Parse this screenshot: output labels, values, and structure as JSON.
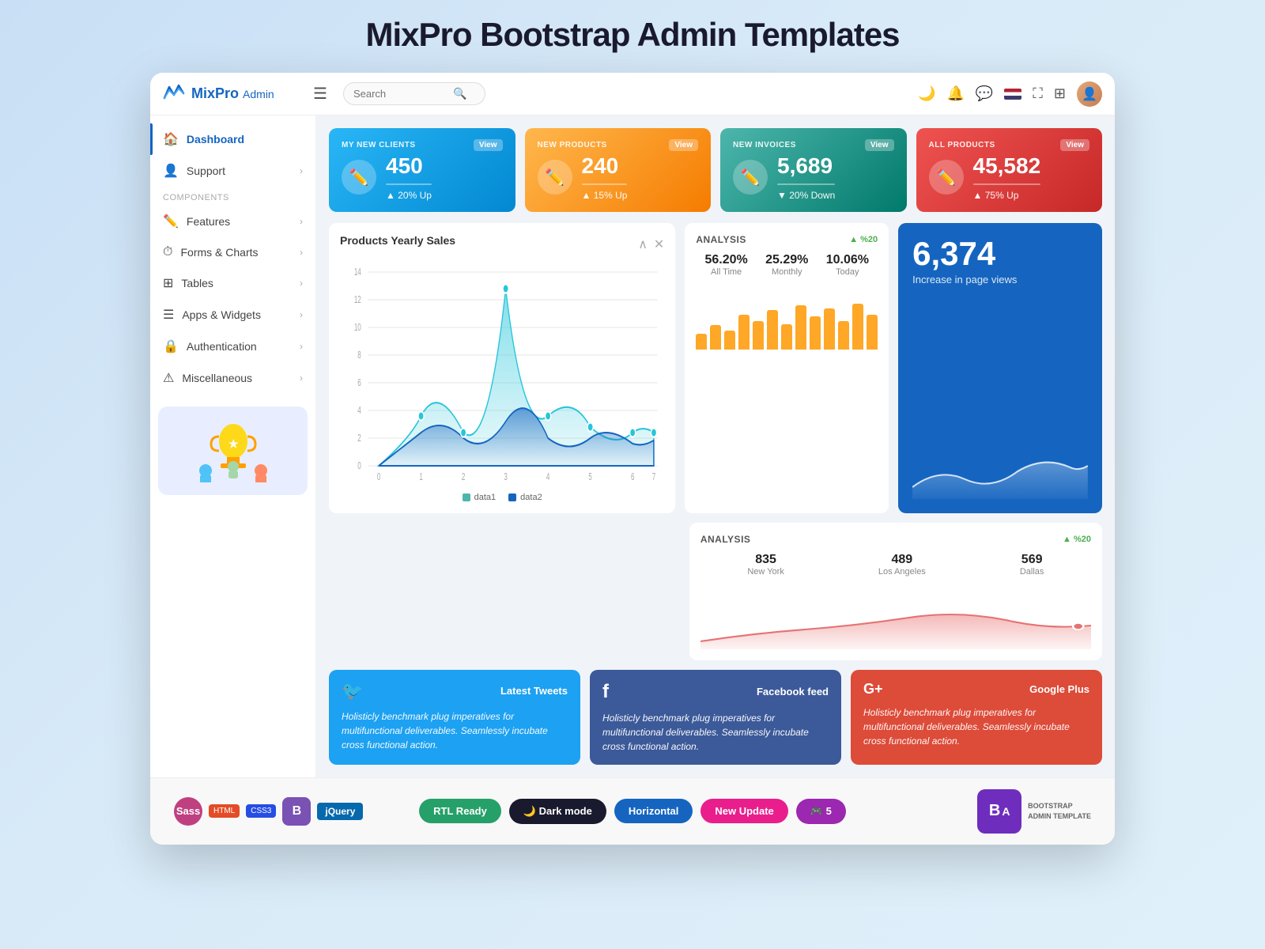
{
  "page": {
    "title": "MixPro Bootstrap Admin Templates"
  },
  "topbar": {
    "logo_brand": "MixPro",
    "logo_sub": "Admin",
    "search_placeholder": "Search",
    "hamburger_label": "☰"
  },
  "sidebar": {
    "items": [
      {
        "label": "Dashboard",
        "icon": "🏠",
        "active": true
      },
      {
        "label": "Support",
        "icon": "👤",
        "has_arrow": true
      },
      {
        "label": "Features",
        "icon": "✏️",
        "has_arrow": true
      },
      {
        "label": "Forms & Charts",
        "icon": "⏱",
        "has_arrow": true
      },
      {
        "label": "Tables",
        "icon": "⊞",
        "has_arrow": true
      },
      {
        "label": "Apps & Widgets",
        "icon": "☰",
        "has_arrow": true
      },
      {
        "label": "Authentication",
        "icon": "🔒",
        "has_arrow": true
      },
      {
        "label": "Miscellaneous",
        "icon": "⚠",
        "has_arrow": true
      }
    ],
    "section_label": "Components"
  },
  "stat_cards": [
    {
      "label": "MY NEW CLIENTS",
      "value": "450",
      "change": "20% Up",
      "change_dir": "up",
      "view_label": "View",
      "color": "blue"
    },
    {
      "label": "NEW PRODUCTS",
      "value": "240",
      "change": "15% Up",
      "change_dir": "up",
      "view_label": "View",
      "color": "orange"
    },
    {
      "label": "NEW INVOICES",
      "value": "5,689",
      "change": "20% Down",
      "change_dir": "down",
      "view_label": "View",
      "color": "teal"
    },
    {
      "label": "ALL PRODUCTS",
      "value": "45,582",
      "change": "75% Up",
      "change_dir": "up",
      "view_label": "View",
      "color": "red"
    }
  ],
  "yearly_chart": {
    "title": "Products Yearly Sales",
    "data1_label": "data1",
    "data2_label": "data2"
  },
  "analysis1": {
    "label": "ANALYSIS",
    "badge": "▲ %20",
    "stats": [
      {
        "value": "56.20%",
        "label": "All Time"
      },
      {
        "value": "25.29%",
        "label": "Monthly"
      },
      {
        "value": "10.06%",
        "label": "Today"
      }
    ],
    "bars": [
      3,
      5,
      4,
      7,
      6,
      8,
      5,
      9,
      7,
      8,
      6,
      9,
      7
    ]
  },
  "big_card": {
    "number": "6,374",
    "label": "Increase in page views"
  },
  "analysis2": {
    "label": "ANALYSIS",
    "badge": "▲ %20",
    "stats": [
      {
        "value": "835",
        "label": "New York"
      },
      {
        "value": "489",
        "label": "Los Angeles"
      },
      {
        "value": "569",
        "label": "Dallas"
      }
    ]
  },
  "social_cards": [
    {
      "platform": "twitter",
      "icon": "𝕏",
      "title": "Latest Tweets",
      "text": "Holisticly benchmark plug imperatives for multifunctional deliverables. Seamlessly incubate cross functional action."
    },
    {
      "platform": "facebook",
      "icon": "f",
      "title": "Facebook feed",
      "text": "Holisticly benchmark plug imperatives for multifunctional deliverables. Seamlessly incubate cross functional action."
    },
    {
      "platform": "gplus",
      "icon": "G+",
      "title": "Google Plus",
      "text": "Holisticly benchmark plug imperatives for multifunctional deliverables. Seamlessly incubate cross functional action."
    }
  ],
  "bottom_bar": {
    "feature_buttons": [
      {
        "label": "RTL Ready",
        "style": "green"
      },
      {
        "label": "🌙 Dark mode",
        "style": "dark"
      },
      {
        "label": "Horizontal",
        "style": "blue"
      },
      {
        "label": "New Update",
        "style": "pink"
      },
      {
        "label": "🎮 5",
        "style": "purple"
      }
    ],
    "tech_labels": [
      "Sass",
      "HTML",
      "CSS3",
      "Bootstrap",
      "jQuery"
    ],
    "bs_label": "BOOTSTRAP\nADMIN TEMPLATE"
  }
}
